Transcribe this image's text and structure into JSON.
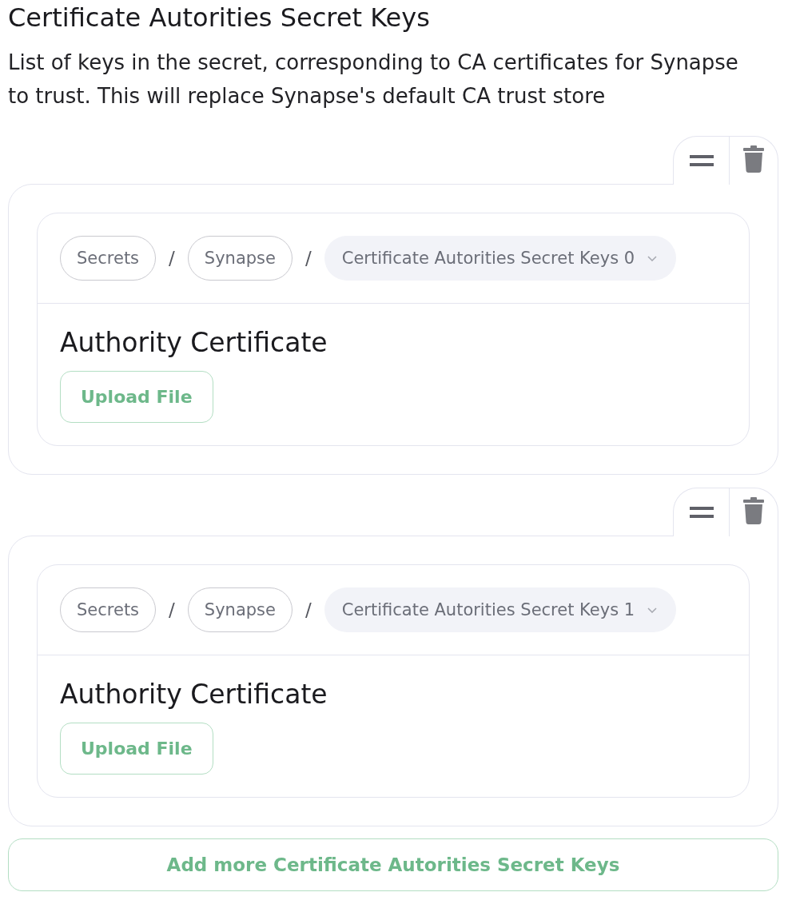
{
  "title": "Certificate Autorities Secret Keys",
  "description": "List of keys in the secret, corresponding to CA certificates for Synapse to trust. This will replace Synapse's default CA trust store",
  "items": [
    {
      "breadcrumb": [
        {
          "kind": "link",
          "label": "Secrets"
        },
        {
          "kind": "separator",
          "label": "/"
        },
        {
          "kind": "link",
          "label": "Synapse"
        },
        {
          "kind": "separator",
          "label": "/"
        },
        {
          "kind": "dropdown",
          "label": "Certificate Autorities Secret Keys 0"
        }
      ],
      "field_label": "Authority Certificate",
      "upload_button": "Upload File"
    },
    {
      "breadcrumb": [
        {
          "kind": "link",
          "label": "Secrets"
        },
        {
          "kind": "separator",
          "label": "/"
        },
        {
          "kind": "link",
          "label": "Synapse"
        },
        {
          "kind": "separator",
          "label": "/"
        },
        {
          "kind": "dropdown",
          "label": "Certificate Autorities Secret Keys 1"
        }
      ],
      "field_label": "Authority Certificate",
      "upload_button": "Upload File"
    }
  ],
  "add_button": "Add more Certificate Autorities Secret Keys"
}
